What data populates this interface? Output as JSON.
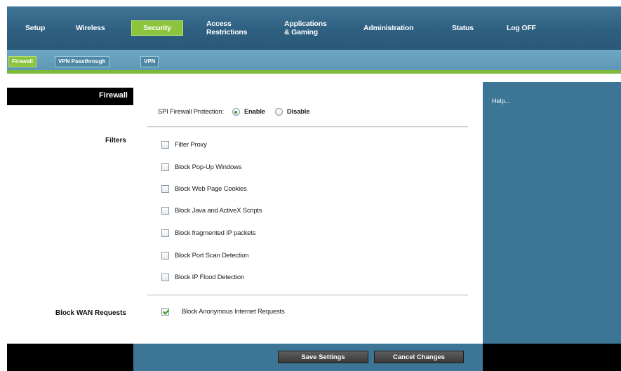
{
  "nav": {
    "items": [
      {
        "label": "Setup"
      },
      {
        "label": "Wireless"
      },
      {
        "label": "Security"
      },
      {
        "label": "Access\nRestrictions"
      },
      {
        "label": "Applications\n& Gaming"
      },
      {
        "label": "Administration"
      },
      {
        "label": "Status"
      },
      {
        "label": "Log OFF"
      }
    ],
    "active_index": 2
  },
  "subtabs": [
    {
      "label": "Firewall"
    },
    {
      "label": "VPN Passthrough"
    },
    {
      "label": "VPN"
    }
  ],
  "left": {
    "section_title": "Firewall",
    "filters_label": "Filters",
    "block_wan_label": "Block WAN Requests"
  },
  "firewall": {
    "spi_label": "SPI Firewall Protection:",
    "enable_label": "Enable",
    "disable_label": "Disable",
    "selected": "Enable"
  },
  "filters": [
    {
      "label": "Filter Proxy",
      "checked": false
    },
    {
      "label": "Block Pop-Up Windows",
      "checked": false
    },
    {
      "label": "Block Web Page Cookies",
      "checked": false
    },
    {
      "label": "Block Java and ActiveX Scripts",
      "checked": false
    },
    {
      "label": "Block fragmented IP packets",
      "checked": false
    },
    {
      "label": "Block Port Scan Detection",
      "checked": false
    },
    {
      "label": "Block IP Flood Detection",
      "checked": false
    }
  ],
  "wan": {
    "label": "Block Anonymous Internet Requests",
    "checked": true
  },
  "help": {
    "label": "Help..."
  },
  "footer": {
    "save_label": "Save Settings",
    "cancel_label": "Cancel Changes"
  },
  "colors": {
    "nav_bg": "#2e5f80",
    "accent_green": "#8dc43e",
    "help_bg": "#3d7596"
  }
}
